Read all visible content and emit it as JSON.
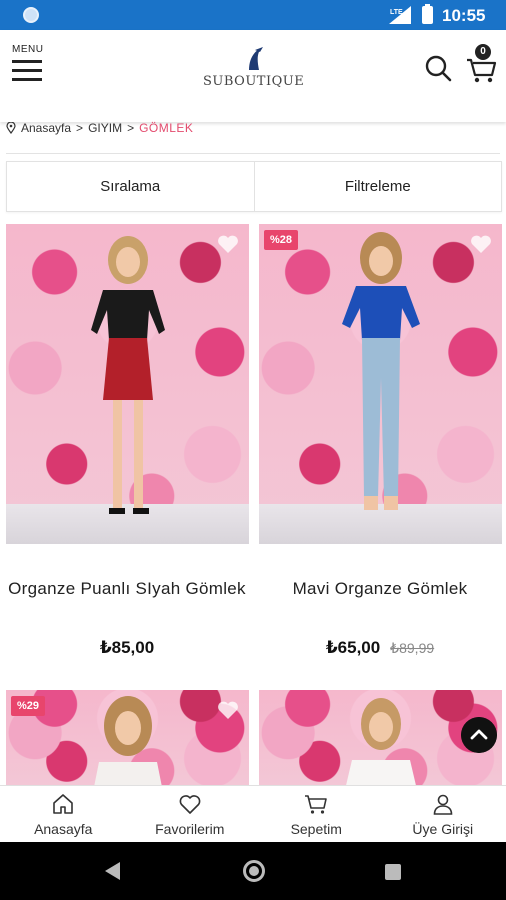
{
  "status_bar": {
    "time": "10:55",
    "network": "LTE"
  },
  "header": {
    "menu_label": "MENU",
    "logo_text": "SUBOUTIQUE",
    "cart_count": "0"
  },
  "breadcrumb": [
    {
      "label": "Anasayfa"
    },
    {
      "label": ">"
    },
    {
      "label": "GIYIM"
    },
    {
      "label": ">"
    },
    {
      "label": "GÖMLEK"
    }
  ],
  "controls": {
    "sort_label": "Sıralama",
    "filter_label": "Filtreleme"
  },
  "products": [
    {
      "name": "Organze Puanlı SIyah Gömlek",
      "price": "₺85,00",
      "old_price": "",
      "badge": ""
    },
    {
      "name": "Mavi Organze Gömlek",
      "price": "₺65,00",
      "old_price": "₺89,99",
      "badge": "%28"
    },
    {
      "name": "",
      "price": "",
      "old_price": "",
      "badge": "%29"
    },
    {
      "name": "",
      "price": "",
      "old_price": "",
      "badge": ""
    }
  ],
  "bottom_nav": [
    {
      "label": "Anasayfa",
      "icon": "home-icon"
    },
    {
      "label": "Favorilerim",
      "icon": "heart-icon"
    },
    {
      "label": "Sepetim",
      "icon": "cart-icon"
    },
    {
      "label": "Üye Girişi",
      "icon": "user-icon"
    }
  ],
  "colors": {
    "status_bar": "#1a73c8",
    "accent": "#e34b6e",
    "badge": "#e8456c"
  }
}
